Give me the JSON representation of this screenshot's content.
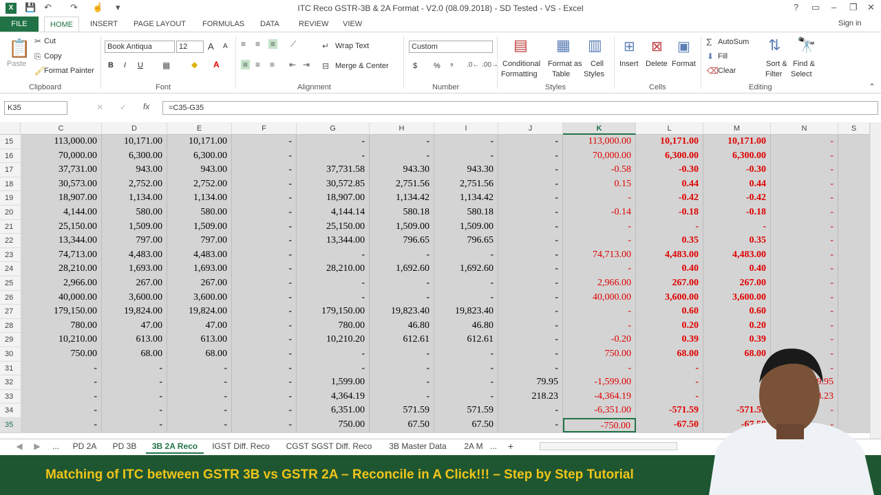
{
  "window": {
    "title": "ITC Reco GSTR-3B & 2A Format - V2.0 (08.09.2018) - SD Tested - VS - Excel",
    "app_icon_label": "X",
    "help": "?",
    "ribbon_display": "▭",
    "minimize": "–",
    "restore": "❐",
    "close": "✕"
  },
  "quick_access": {
    "save": "💾",
    "undo": "↶",
    "redo": "↷",
    "touch": "☝",
    "customize": "▾"
  },
  "ribbon_tabs": {
    "file": "FILE",
    "tabs": [
      "HOME",
      "INSERT",
      "PAGE LAYOUT",
      "FORMULAS",
      "DATA",
      "REVIEW",
      "VIEW"
    ],
    "active": "HOME",
    "signin": "Sign in"
  },
  "ribbon": {
    "clipboard": {
      "paste": "Paste",
      "cut": "Cut",
      "copy": "Copy",
      "format_painter": "Format Painter",
      "group": "Clipboard"
    },
    "font": {
      "family": "Book Antiqua",
      "size": "12",
      "grow": "A",
      "shrink": "A",
      "bold": "B",
      "italic": "I",
      "underline": "U",
      "group": "Font"
    },
    "alignment": {
      "wrap_text": "Wrap Text",
      "merge_center": "Merge & Center",
      "group": "Alignment"
    },
    "number": {
      "format": "Custom",
      "currency": "$",
      "percent": "%",
      "comma": "⁹",
      "group": "Number"
    },
    "styles": {
      "conditional": "Conditional",
      "conditional2": "Formatting",
      "format_table": "Format as",
      "format_table2": "Table",
      "cell_styles": "Cell",
      "cell_styles2": "Styles",
      "group": "Styles"
    },
    "cells": {
      "insert": "Insert",
      "delete": "Delete",
      "format": "Format",
      "group": "Cells"
    },
    "editing": {
      "autosum": "AutoSum",
      "fill": "Fill",
      "clear": "Clear",
      "sort": "Sort &",
      "sort2": "Filter",
      "find": "Find &",
      "find2": "Select",
      "group": "Editing"
    }
  },
  "formula_bar": {
    "name_box": "K35",
    "fx": "fx",
    "formula": "=C35-G35"
  },
  "columns": [
    "C",
    "D",
    "E",
    "F",
    "G",
    "H",
    "I",
    "J",
    "K",
    "L",
    "M",
    "N",
    "S"
  ],
  "selected_column": "K",
  "rows": [
    {
      "num": "15",
      "C": "113,000.00",
      "D": "10,171.00",
      "E": "10,171.00",
      "F": "-",
      "G": "-",
      "H": "-",
      "I": "-",
      "J": "-",
      "K": "113,000.00",
      "L": "10,171.00",
      "M": "10,171.00",
      "N": "-"
    },
    {
      "num": "16",
      "C": "70,000.00",
      "D": "6,300.00",
      "E": "6,300.00",
      "F": "-",
      "G": "-",
      "H": "-",
      "I": "-",
      "J": "-",
      "K": "70,000.00",
      "L": "6,300.00",
      "M": "6,300.00",
      "N": "-"
    },
    {
      "num": "17",
      "C": "37,731.00",
      "D": "943.00",
      "E": "943.00",
      "F": "-",
      "G": "37,731.58",
      "H": "943.30",
      "I": "943.30",
      "J": "-",
      "K": "-0.58",
      "L": "-0.30",
      "M": "-0.30",
      "N": "-"
    },
    {
      "num": "18",
      "C": "30,573.00",
      "D": "2,752.00",
      "E": "2,752.00",
      "F": "-",
      "G": "30,572.85",
      "H": "2,751.56",
      "I": "2,751.56",
      "J": "-",
      "K": "0.15",
      "L": "0.44",
      "M": "0.44",
      "N": "-"
    },
    {
      "num": "19",
      "C": "18,907.00",
      "D": "1,134.00",
      "E": "1,134.00",
      "F": "-",
      "G": "18,907.00",
      "H": "1,134.42",
      "I": "1,134.42",
      "J": "-",
      "K": "-",
      "L": "-0.42",
      "M": "-0.42",
      "N": "-"
    },
    {
      "num": "20",
      "C": "4,144.00",
      "D": "580.00",
      "E": "580.00",
      "F": "-",
      "G": "4,144.14",
      "H": "580.18",
      "I": "580.18",
      "J": "-",
      "K": "-0.14",
      "L": "-0.18",
      "M": "-0.18",
      "N": "-"
    },
    {
      "num": "21",
      "C": "25,150.00",
      "D": "1,509.00",
      "E": "1,509.00",
      "F": "-",
      "G": "25,150.00",
      "H": "1,509.00",
      "I": "1,509.00",
      "J": "-",
      "K": "-",
      "L": "-",
      "M": "-",
      "N": "-"
    },
    {
      "num": "22",
      "C": "13,344.00",
      "D": "797.00",
      "E": "797.00",
      "F": "-",
      "G": "13,344.00",
      "H": "796.65",
      "I": "796.65",
      "J": "-",
      "K": "-",
      "L": "0.35",
      "M": "0.35",
      "N": "-"
    },
    {
      "num": "23",
      "C": "74,713.00",
      "D": "4,483.00",
      "E": "4,483.00",
      "F": "-",
      "G": "-",
      "H": "-",
      "I": "-",
      "J": "-",
      "K": "74,713.00",
      "L": "4,483.00",
      "M": "4,483.00",
      "N": "-"
    },
    {
      "num": "24",
      "C": "28,210.00",
      "D": "1,693.00",
      "E": "1,693.00",
      "F": "-",
      "G": "28,210.00",
      "H": "1,692.60",
      "I": "1,692.60",
      "J": "-",
      "K": "-",
      "L": "0.40",
      "M": "0.40",
      "N": "-"
    },
    {
      "num": "25",
      "C": "2,966.00",
      "D": "267.00",
      "E": "267.00",
      "F": "-",
      "G": "-",
      "H": "-",
      "I": "-",
      "J": "-",
      "K": "2,966.00",
      "L": "267.00",
      "M": "267.00",
      "N": "-"
    },
    {
      "num": "26",
      "C": "40,000.00",
      "D": "3,600.00",
      "E": "3,600.00",
      "F": "-",
      "G": "-",
      "H": "-",
      "I": "-",
      "J": "-",
      "K": "40,000.00",
      "L": "3,600.00",
      "M": "3,600.00",
      "N": "-"
    },
    {
      "num": "27",
      "C": "179,150.00",
      "D": "19,824.00",
      "E": "19,824.00",
      "F": "-",
      "G": "179,150.00",
      "H": "19,823.40",
      "I": "19,823.40",
      "J": "-",
      "K": "-",
      "L": "0.60",
      "M": "0.60",
      "N": "-"
    },
    {
      "num": "28",
      "C": "780.00",
      "D": "47.00",
      "E": "47.00",
      "F": "-",
      "G": "780.00",
      "H": "46.80",
      "I": "46.80",
      "J": "-",
      "K": "-",
      "L": "0.20",
      "M": "0.20",
      "N": "-"
    },
    {
      "num": "29",
      "C": "10,210.00",
      "D": "613.00",
      "E": "613.00",
      "F": "-",
      "G": "10,210.20",
      "H": "612.61",
      "I": "612.61",
      "J": "-",
      "K": "-0.20",
      "L": "0.39",
      "M": "0.39",
      "N": "-"
    },
    {
      "num": "30",
      "C": "750.00",
      "D": "68.00",
      "E": "68.00",
      "F": "-",
      "G": "-",
      "H": "-",
      "I": "-",
      "J": "-",
      "K": "750.00",
      "L": "68.00",
      "M": "68.00",
      "N": "-"
    },
    {
      "num": "31",
      "C": "-",
      "D": "-",
      "E": "-",
      "F": "-",
      "G": "-",
      "H": "-",
      "I": "-",
      "J": "-",
      "K": "-",
      "L": "-",
      "M": "-",
      "N": "-"
    },
    {
      "num": "32",
      "C": "-",
      "D": "-",
      "E": "-",
      "F": "-",
      "G": "1,599.00",
      "H": "-",
      "I": "-",
      "J": "79.95",
      "K": "-1,599.00",
      "L": "-",
      "M": "-",
      "N": "-79.95"
    },
    {
      "num": "33",
      "C": "-",
      "D": "-",
      "E": "-",
      "F": "-",
      "G": "4,364.19",
      "H": "-",
      "I": "-",
      "J": "218.23",
      "K": "-4,364.19",
      "L": "-",
      "M": "-",
      "N": "-218.23"
    },
    {
      "num": "34",
      "C": "-",
      "D": "-",
      "E": "-",
      "F": "-",
      "G": "6,351.00",
      "H": "571.59",
      "I": "571.59",
      "J": "-",
      "K": "-6,351.00",
      "L": "-571.59",
      "M": "-571.59",
      "N": "-"
    },
    {
      "num": "35",
      "C": "-",
      "D": "-",
      "E": "-",
      "F": "-",
      "G": "750.00",
      "H": "67.50",
      "I": "67.50",
      "J": "-",
      "K": "-750.00",
      "L": "-67.50",
      "M": "-67.50",
      "N": "-"
    }
  ],
  "sheet_tabs": {
    "nav_prev": "◀",
    "nav_next": "▶",
    "more": "...",
    "tabs": [
      "PD 2A",
      "PD 3B",
      "3B 2A Reco",
      "IGST Diff. Reco",
      "CGST SGST Diff. Reco",
      "3B Master Data",
      "2A M"
    ],
    "active": "3B 2A Reco",
    "more_right": "...",
    "add": "+"
  },
  "banner": {
    "text": "Matching of ITC between GSTR 3B vs GSTR 2A – Reconcile in A Click!!! – Step by Step Tutorial"
  },
  "colors": {
    "excel_green": "#217346",
    "banner_bg": "#1e5631",
    "banner_text": "#f0c419",
    "negative_red": "#e00000"
  }
}
